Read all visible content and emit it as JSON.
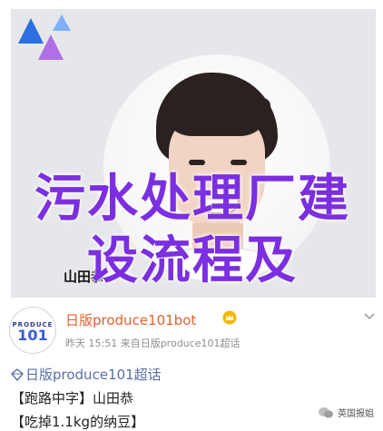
{
  "overlay": {
    "line1": "污水处理厂建",
    "line2": "设流程及",
    "color": "#7b2fe0"
  },
  "profile_card": {
    "name": "山田恭"
  },
  "post": {
    "avatar_top": "PRODUCE",
    "avatar_num": "101",
    "username": "日版produce101bot",
    "timestamp": "昨天 15:51",
    "source_sep": "来自",
    "source": "日版produce101超话",
    "username_color": "#e0622d"
  },
  "content": {
    "topic": "日版produce101超话",
    "line2": "【跑路中字】山田恭",
    "line3": "【吃掉1.1kg的纳豆】"
  },
  "watermark": {
    "text": "英国报姐"
  }
}
